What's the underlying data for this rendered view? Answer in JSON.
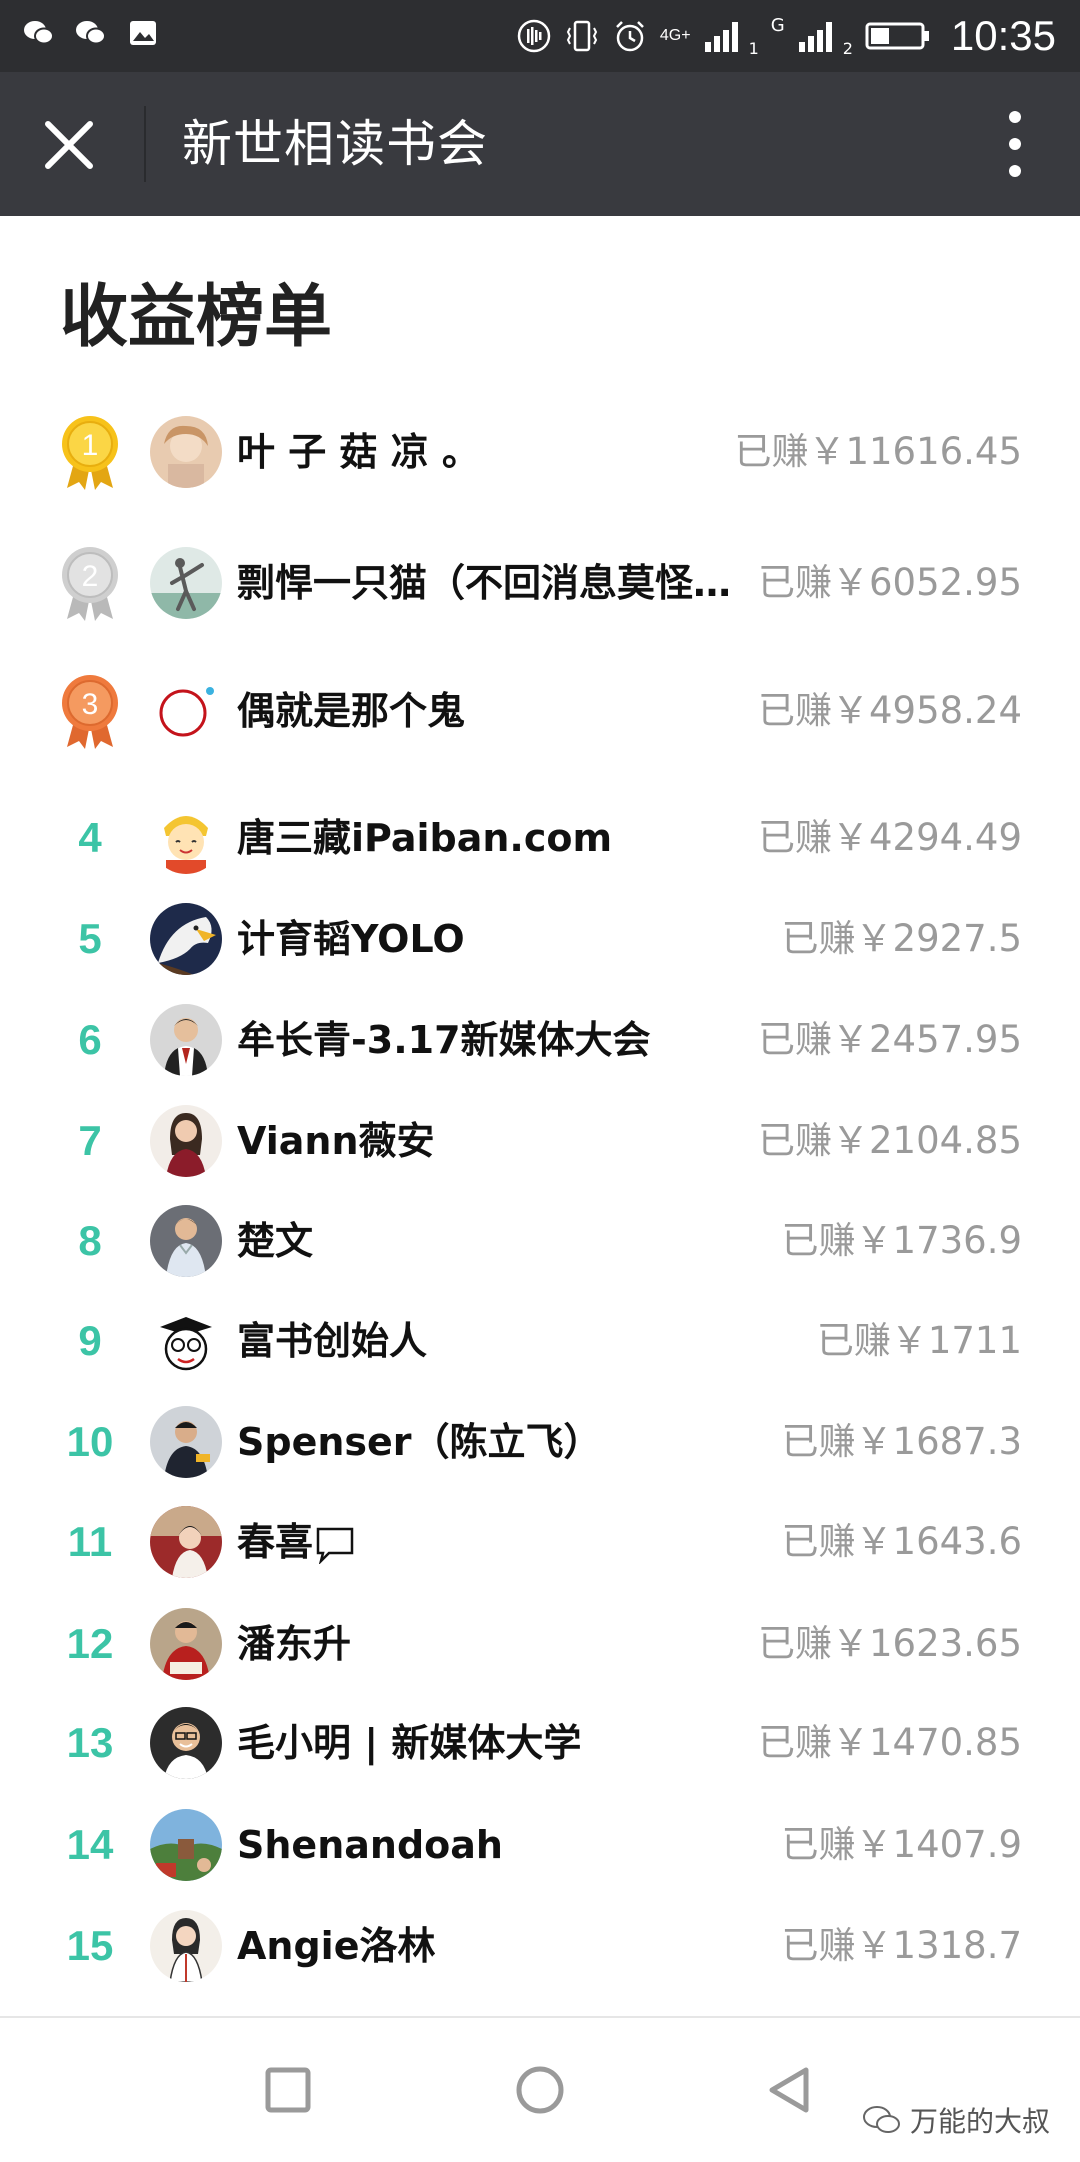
{
  "status_bar": {
    "time": "10:35",
    "network": "4G+",
    "sim2_label": "G",
    "sim1_index": "1",
    "sim2_index": "2"
  },
  "title_bar": {
    "title": "新世相读书会"
  },
  "page": {
    "heading": "收益榜单"
  },
  "ranking": [
    {
      "rank": "1",
      "name": "叶 子 菇 凉 。",
      "earned": "已赚￥11616.45",
      "medal": "gold"
    },
    {
      "rank": "2",
      "name": "剽悍一只猫（不回消息莫怪…",
      "earned": "已赚￥6052.95",
      "medal": "silver"
    },
    {
      "rank": "3",
      "name": "偶就是那个鬼",
      "earned": "已赚￥4958.24",
      "medal": "bronze"
    },
    {
      "rank": "4",
      "name": "唐三藏iPaiban.com",
      "earned": "已赚￥4294.49"
    },
    {
      "rank": "5",
      "name": "计育韬YOLO",
      "earned": "已赚￥2927.5"
    },
    {
      "rank": "6",
      "name": "牟长青-3.17新媒体大会",
      "earned": "已赚￥2457.95"
    },
    {
      "rank": "7",
      "name": "Viann薇安",
      "earned": "已赚￥2104.85"
    },
    {
      "rank": "8",
      "name": "楚文",
      "earned": "已赚￥1736.9"
    },
    {
      "rank": "9",
      "name": "富书创始人",
      "earned": "已赚￥1711"
    },
    {
      "rank": "10",
      "name": "Spenser（陈立飞）",
      "earned": "已赚￥1687.3"
    },
    {
      "rank": "11",
      "name": "春喜",
      "earned": "已赚￥1643.6"
    },
    {
      "rank": "12",
      "name": "潘东升",
      "earned": "已赚￥1623.65"
    },
    {
      "rank": "13",
      "name": "毛小明 | 新媒体大学",
      "earned": "已赚￥1470.85"
    },
    {
      "rank": "14",
      "name": "Shenandoah",
      "earned": "已赚￥1407.9"
    },
    {
      "rank": "15",
      "name": "Angie洛林",
      "earned": "已赚￥1318.7"
    }
  ],
  "watermark": {
    "text": "万能的大叔"
  },
  "colors": {
    "rank_accent": "#3cc4a6",
    "title_bar_bg": "#393a3f",
    "status_bar_bg": "#2d2e31"
  }
}
